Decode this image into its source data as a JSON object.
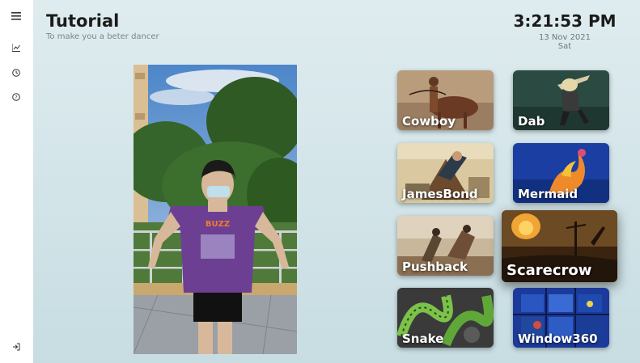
{
  "header": {
    "title": "Tutorial",
    "subtitle": "To make you a beter dancer"
  },
  "clock": {
    "time": "3:21:53 PM",
    "date": "13 Nov 2021",
    "day": "Sat"
  },
  "sidebar": {
    "items": [
      {
        "icon": "menu-icon"
      },
      {
        "icon": "chart-icon"
      },
      {
        "icon": "clock-icon"
      },
      {
        "icon": "help-icon"
      },
      {
        "icon": "logout-icon"
      }
    ]
  },
  "dances": [
    {
      "label": "Cowboy"
    },
    {
      "label": "Dab"
    },
    {
      "label": "JamesBond"
    },
    {
      "label": "Mermaid"
    },
    {
      "label": "Pushback"
    },
    {
      "label": "Scarecrow"
    },
    {
      "label": "Snake"
    },
    {
      "label": "Window360"
    }
  ],
  "colors": {
    "sidebar_bg": "#ffffff",
    "main_bg_top": "#dfecef",
    "main_bg_bottom": "#c7dde2",
    "title_text": "#1b1b1b",
    "muted_text": "#7c8488",
    "card_label": "#ffffff"
  }
}
